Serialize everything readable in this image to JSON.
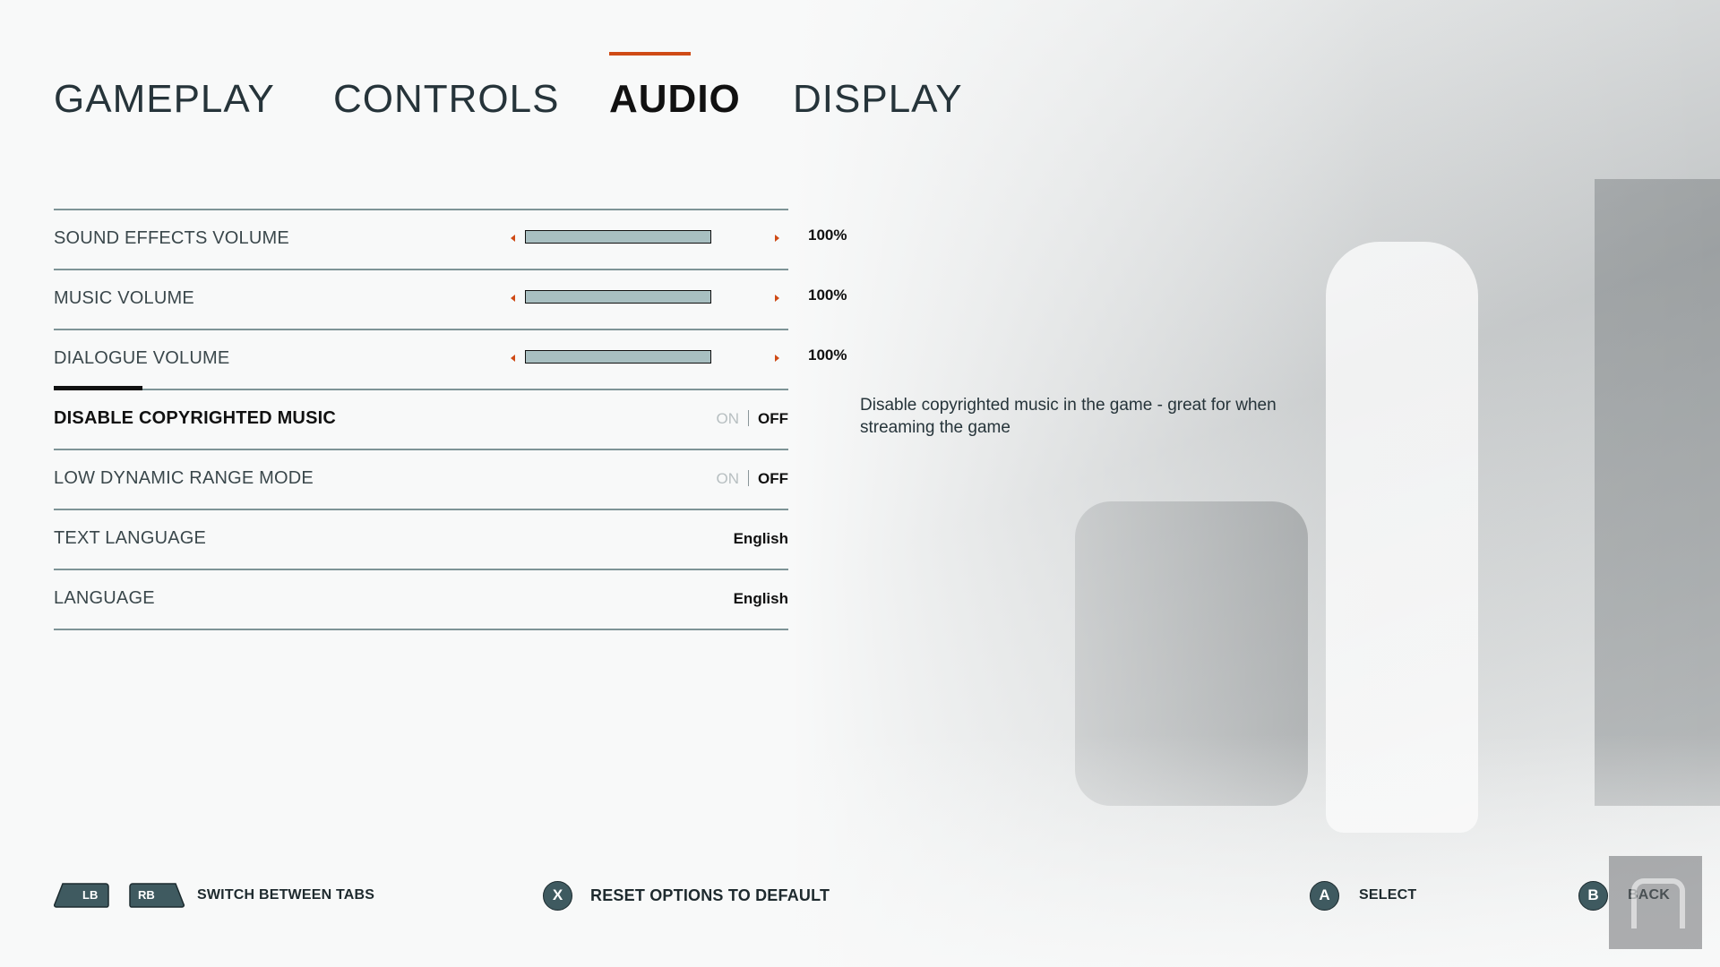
{
  "tabs": [
    {
      "label": "GAMEPLAY",
      "active": false
    },
    {
      "label": "CONTROLS",
      "active": false
    },
    {
      "label": "AUDIO",
      "active": true
    },
    {
      "label": "DISPLAY",
      "active": false
    }
  ],
  "accent_color": "#cf4b16",
  "settings": [
    {
      "label": "SOUND EFFECTS VOLUME",
      "type": "slider",
      "value": "100%",
      "level": 1.0
    },
    {
      "label": "MUSIC VOLUME",
      "type": "slider",
      "value": "100%",
      "level": 1.0
    },
    {
      "label": "DIALOGUE VOLUME",
      "type": "slider",
      "value": "100%",
      "level": 1.0
    },
    {
      "label": "DISABLE COPYRIGHTED MUSIC",
      "type": "toggle",
      "on_label": "ON",
      "off_label": "OFF",
      "value": "OFF",
      "selected": true
    },
    {
      "label": "LOW DYNAMIC RANGE MODE",
      "type": "toggle",
      "on_label": "ON",
      "off_label": "OFF",
      "value": "OFF"
    },
    {
      "label": "TEXT LANGUAGE",
      "type": "select",
      "value": "English"
    },
    {
      "label": "LANGUAGE",
      "type": "select",
      "value": "English"
    }
  ],
  "description": "Disable copyrighted music in the game - great for when streaming the game",
  "footer": {
    "lb": "LB",
    "rb": "RB",
    "switch_tabs": "SWITCH BETWEEN TABS",
    "x_button": "X",
    "reset": "RESET OPTIONS TO DEFAULT",
    "a_button": "A",
    "select": "SELECT",
    "b_button": "B",
    "back": "BACK"
  },
  "icons": {
    "slider_left": "arrow-left-icon",
    "slider_right": "arrow-right-icon",
    "watermark": "engadget-logo-icon"
  }
}
